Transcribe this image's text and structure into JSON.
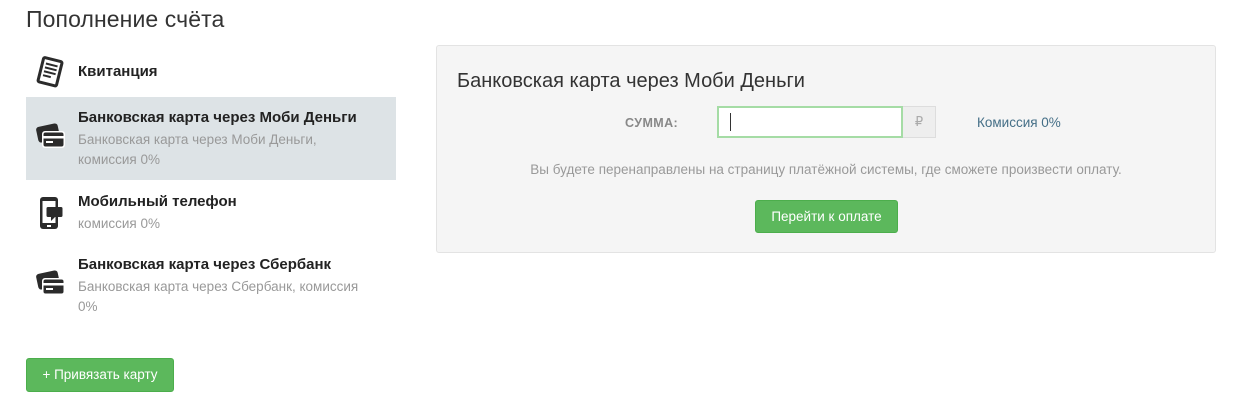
{
  "page": {
    "title": "Пополнение счёта"
  },
  "methods": [
    {
      "title": "Квитанция",
      "desc": "",
      "icon": "receipt-icon"
    },
    {
      "title": "Банковская карта через Моби Деньги",
      "desc": "Банковская карта через Моби Деньги, комиссия 0%",
      "icon": "credit-card-icon",
      "selected": true
    },
    {
      "title": "Мобильный телефон",
      "desc": "комиссия 0%",
      "icon": "mobile-phone-icon"
    },
    {
      "title": "Банковская карта через Сбербанк",
      "desc": "Банковская карта через Сбербанк, комиссия 0%",
      "icon": "credit-card-icon"
    }
  ],
  "bind_card": {
    "label": "+ Привязать карту"
  },
  "panel": {
    "title": "Банковская карта через Моби Деньги",
    "sum_label": "СУММА:",
    "sum_value": "",
    "currency": "₽",
    "commission": "Комиссия 0%",
    "redirect_note": "Вы будете перенаправлены на страницу платёжной системы, где сможете произвести оплату.",
    "pay_button": "Перейти к оплате"
  },
  "colors": {
    "selected_bg": "#dde3e6",
    "button_green": "#5cb85c",
    "link_blue": "#456f87",
    "input_focus_border": "#a5dca5"
  }
}
